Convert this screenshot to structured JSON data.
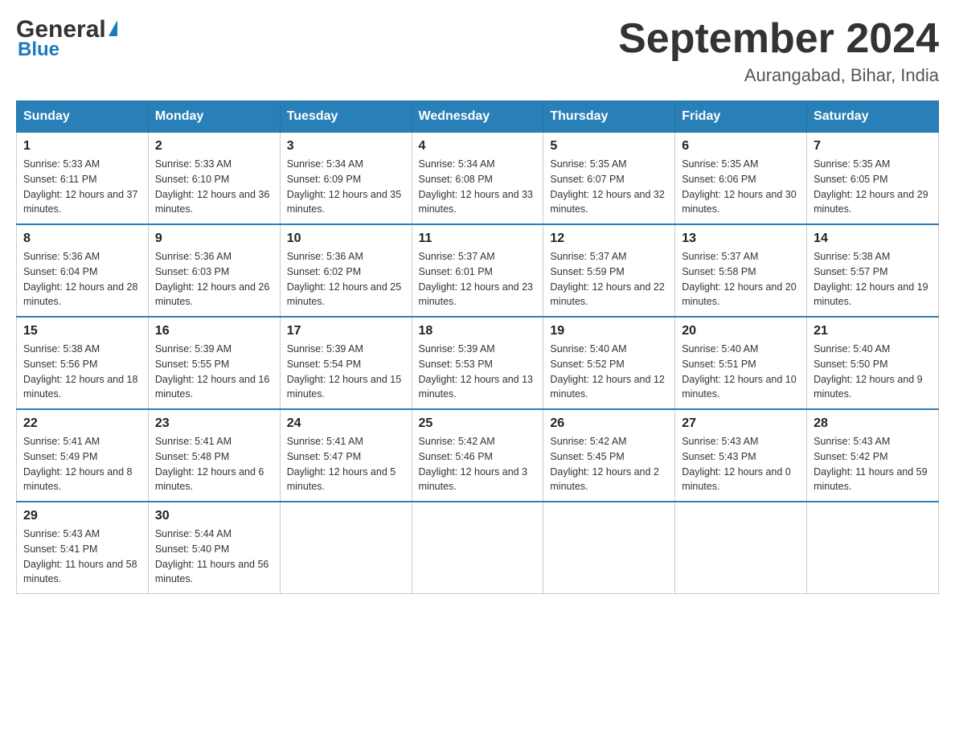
{
  "header": {
    "logo_main": "General",
    "logo_blue": "Blue",
    "month_title": "September 2024",
    "location": "Aurangabad, Bihar, India"
  },
  "weekdays": [
    "Sunday",
    "Monday",
    "Tuesday",
    "Wednesday",
    "Thursday",
    "Friday",
    "Saturday"
  ],
  "weeks": [
    [
      {
        "day": "1",
        "sunrise": "5:33 AM",
        "sunset": "6:11 PM",
        "daylight": "12 hours and 37 minutes."
      },
      {
        "day": "2",
        "sunrise": "5:33 AM",
        "sunset": "6:10 PM",
        "daylight": "12 hours and 36 minutes."
      },
      {
        "day": "3",
        "sunrise": "5:34 AM",
        "sunset": "6:09 PM",
        "daylight": "12 hours and 35 minutes."
      },
      {
        "day": "4",
        "sunrise": "5:34 AM",
        "sunset": "6:08 PM",
        "daylight": "12 hours and 33 minutes."
      },
      {
        "day": "5",
        "sunrise": "5:35 AM",
        "sunset": "6:07 PM",
        "daylight": "12 hours and 32 minutes."
      },
      {
        "day": "6",
        "sunrise": "5:35 AM",
        "sunset": "6:06 PM",
        "daylight": "12 hours and 30 minutes."
      },
      {
        "day": "7",
        "sunrise": "5:35 AM",
        "sunset": "6:05 PM",
        "daylight": "12 hours and 29 minutes."
      }
    ],
    [
      {
        "day": "8",
        "sunrise": "5:36 AM",
        "sunset": "6:04 PM",
        "daylight": "12 hours and 28 minutes."
      },
      {
        "day": "9",
        "sunrise": "5:36 AM",
        "sunset": "6:03 PM",
        "daylight": "12 hours and 26 minutes."
      },
      {
        "day": "10",
        "sunrise": "5:36 AM",
        "sunset": "6:02 PM",
        "daylight": "12 hours and 25 minutes."
      },
      {
        "day": "11",
        "sunrise": "5:37 AM",
        "sunset": "6:01 PM",
        "daylight": "12 hours and 23 minutes."
      },
      {
        "day": "12",
        "sunrise": "5:37 AM",
        "sunset": "5:59 PM",
        "daylight": "12 hours and 22 minutes."
      },
      {
        "day": "13",
        "sunrise": "5:37 AM",
        "sunset": "5:58 PM",
        "daylight": "12 hours and 20 minutes."
      },
      {
        "day": "14",
        "sunrise": "5:38 AM",
        "sunset": "5:57 PM",
        "daylight": "12 hours and 19 minutes."
      }
    ],
    [
      {
        "day": "15",
        "sunrise": "5:38 AM",
        "sunset": "5:56 PM",
        "daylight": "12 hours and 18 minutes."
      },
      {
        "day": "16",
        "sunrise": "5:39 AM",
        "sunset": "5:55 PM",
        "daylight": "12 hours and 16 minutes."
      },
      {
        "day": "17",
        "sunrise": "5:39 AM",
        "sunset": "5:54 PM",
        "daylight": "12 hours and 15 minutes."
      },
      {
        "day": "18",
        "sunrise": "5:39 AM",
        "sunset": "5:53 PM",
        "daylight": "12 hours and 13 minutes."
      },
      {
        "day": "19",
        "sunrise": "5:40 AM",
        "sunset": "5:52 PM",
        "daylight": "12 hours and 12 minutes."
      },
      {
        "day": "20",
        "sunrise": "5:40 AM",
        "sunset": "5:51 PM",
        "daylight": "12 hours and 10 minutes."
      },
      {
        "day": "21",
        "sunrise": "5:40 AM",
        "sunset": "5:50 PM",
        "daylight": "12 hours and 9 minutes."
      }
    ],
    [
      {
        "day": "22",
        "sunrise": "5:41 AM",
        "sunset": "5:49 PM",
        "daylight": "12 hours and 8 minutes."
      },
      {
        "day": "23",
        "sunrise": "5:41 AM",
        "sunset": "5:48 PM",
        "daylight": "12 hours and 6 minutes."
      },
      {
        "day": "24",
        "sunrise": "5:41 AM",
        "sunset": "5:47 PM",
        "daylight": "12 hours and 5 minutes."
      },
      {
        "day": "25",
        "sunrise": "5:42 AM",
        "sunset": "5:46 PM",
        "daylight": "12 hours and 3 minutes."
      },
      {
        "day": "26",
        "sunrise": "5:42 AM",
        "sunset": "5:45 PM",
        "daylight": "12 hours and 2 minutes."
      },
      {
        "day": "27",
        "sunrise": "5:43 AM",
        "sunset": "5:43 PM",
        "daylight": "12 hours and 0 minutes."
      },
      {
        "day": "28",
        "sunrise": "5:43 AM",
        "sunset": "5:42 PM",
        "daylight": "11 hours and 59 minutes."
      }
    ],
    [
      {
        "day": "29",
        "sunrise": "5:43 AM",
        "sunset": "5:41 PM",
        "daylight": "11 hours and 58 minutes."
      },
      {
        "day": "30",
        "sunrise": "5:44 AM",
        "sunset": "5:40 PM",
        "daylight": "11 hours and 56 minutes."
      },
      null,
      null,
      null,
      null,
      null
    ]
  ]
}
